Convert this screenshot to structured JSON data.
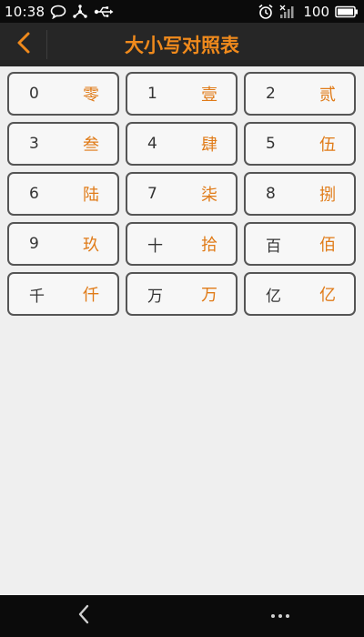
{
  "status_bar": {
    "time": "10:38",
    "battery": "100",
    "icons": [
      "chat-icon",
      "share-icon",
      "usb-icon",
      "alarm-icon",
      "signal-icon",
      "battery-icon"
    ]
  },
  "header": {
    "title": "大小写对照表",
    "back_icon": "chevron-left-icon"
  },
  "colors": {
    "accent": "#f08a1c",
    "header_bg": "#262626",
    "status_bg": "#0b0b0b",
    "page_bg": "#efefef"
  },
  "table": {
    "rows": [
      [
        {
          "digit": "0",
          "upper": "零"
        },
        {
          "digit": "1",
          "upper": "壹"
        },
        {
          "digit": "2",
          "upper": "贰"
        }
      ],
      [
        {
          "digit": "3",
          "upper": "叁"
        },
        {
          "digit": "4",
          "upper": "肆"
        },
        {
          "digit": "5",
          "upper": "伍"
        }
      ],
      [
        {
          "digit": "6",
          "upper": "陆"
        },
        {
          "digit": "7",
          "upper": "柒"
        },
        {
          "digit": "8",
          "upper": "捌"
        }
      ],
      [
        {
          "digit": "9",
          "upper": "玖"
        },
        {
          "digit": "十",
          "upper": "拾"
        },
        {
          "digit": "百",
          "upper": "佰"
        }
      ],
      [
        {
          "digit": "千",
          "upper": "仟"
        },
        {
          "digit": "万",
          "upper": "万"
        },
        {
          "digit": "亿",
          "upper": "亿"
        }
      ]
    ]
  },
  "nav_bar": {
    "back_icon": "nav-back-icon",
    "menu_icon": "more-icon"
  }
}
